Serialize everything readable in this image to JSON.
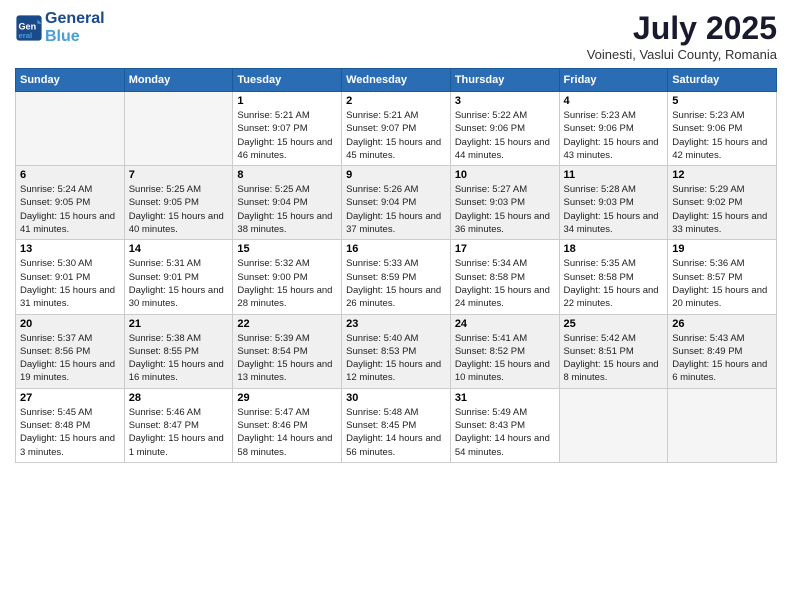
{
  "header": {
    "logo_line1": "General",
    "logo_line2": "Blue",
    "month_title": "July 2025",
    "location": "Voinesti, Vaslui County, Romania"
  },
  "days_of_week": [
    "Sunday",
    "Monday",
    "Tuesday",
    "Wednesday",
    "Thursday",
    "Friday",
    "Saturday"
  ],
  "weeks": [
    [
      {
        "day": "",
        "info": ""
      },
      {
        "day": "",
        "info": ""
      },
      {
        "day": "1",
        "info": "Sunrise: 5:21 AM\nSunset: 9:07 PM\nDaylight: 15 hours and 46 minutes."
      },
      {
        "day": "2",
        "info": "Sunrise: 5:21 AM\nSunset: 9:07 PM\nDaylight: 15 hours and 45 minutes."
      },
      {
        "day": "3",
        "info": "Sunrise: 5:22 AM\nSunset: 9:06 PM\nDaylight: 15 hours and 44 minutes."
      },
      {
        "day": "4",
        "info": "Sunrise: 5:23 AM\nSunset: 9:06 PM\nDaylight: 15 hours and 43 minutes."
      },
      {
        "day": "5",
        "info": "Sunrise: 5:23 AM\nSunset: 9:06 PM\nDaylight: 15 hours and 42 minutes."
      }
    ],
    [
      {
        "day": "6",
        "info": "Sunrise: 5:24 AM\nSunset: 9:05 PM\nDaylight: 15 hours and 41 minutes."
      },
      {
        "day": "7",
        "info": "Sunrise: 5:25 AM\nSunset: 9:05 PM\nDaylight: 15 hours and 40 minutes."
      },
      {
        "day": "8",
        "info": "Sunrise: 5:25 AM\nSunset: 9:04 PM\nDaylight: 15 hours and 38 minutes."
      },
      {
        "day": "9",
        "info": "Sunrise: 5:26 AM\nSunset: 9:04 PM\nDaylight: 15 hours and 37 minutes."
      },
      {
        "day": "10",
        "info": "Sunrise: 5:27 AM\nSunset: 9:03 PM\nDaylight: 15 hours and 36 minutes."
      },
      {
        "day": "11",
        "info": "Sunrise: 5:28 AM\nSunset: 9:03 PM\nDaylight: 15 hours and 34 minutes."
      },
      {
        "day": "12",
        "info": "Sunrise: 5:29 AM\nSunset: 9:02 PM\nDaylight: 15 hours and 33 minutes."
      }
    ],
    [
      {
        "day": "13",
        "info": "Sunrise: 5:30 AM\nSunset: 9:01 PM\nDaylight: 15 hours and 31 minutes."
      },
      {
        "day": "14",
        "info": "Sunrise: 5:31 AM\nSunset: 9:01 PM\nDaylight: 15 hours and 30 minutes."
      },
      {
        "day": "15",
        "info": "Sunrise: 5:32 AM\nSunset: 9:00 PM\nDaylight: 15 hours and 28 minutes."
      },
      {
        "day": "16",
        "info": "Sunrise: 5:33 AM\nSunset: 8:59 PM\nDaylight: 15 hours and 26 minutes."
      },
      {
        "day": "17",
        "info": "Sunrise: 5:34 AM\nSunset: 8:58 PM\nDaylight: 15 hours and 24 minutes."
      },
      {
        "day": "18",
        "info": "Sunrise: 5:35 AM\nSunset: 8:58 PM\nDaylight: 15 hours and 22 minutes."
      },
      {
        "day": "19",
        "info": "Sunrise: 5:36 AM\nSunset: 8:57 PM\nDaylight: 15 hours and 20 minutes."
      }
    ],
    [
      {
        "day": "20",
        "info": "Sunrise: 5:37 AM\nSunset: 8:56 PM\nDaylight: 15 hours and 19 minutes."
      },
      {
        "day": "21",
        "info": "Sunrise: 5:38 AM\nSunset: 8:55 PM\nDaylight: 15 hours and 16 minutes."
      },
      {
        "day": "22",
        "info": "Sunrise: 5:39 AM\nSunset: 8:54 PM\nDaylight: 15 hours and 13 minutes."
      },
      {
        "day": "23",
        "info": "Sunrise: 5:40 AM\nSunset: 8:53 PM\nDaylight: 15 hours and 12 minutes."
      },
      {
        "day": "24",
        "info": "Sunrise: 5:41 AM\nSunset: 8:52 PM\nDaylight: 15 hours and 10 minutes."
      },
      {
        "day": "25",
        "info": "Sunrise: 5:42 AM\nSunset: 8:51 PM\nDaylight: 15 hours and 8 minutes."
      },
      {
        "day": "26",
        "info": "Sunrise: 5:43 AM\nSunset: 8:49 PM\nDaylight: 15 hours and 6 minutes."
      }
    ],
    [
      {
        "day": "27",
        "info": "Sunrise: 5:45 AM\nSunset: 8:48 PM\nDaylight: 15 hours and 3 minutes."
      },
      {
        "day": "28",
        "info": "Sunrise: 5:46 AM\nSunset: 8:47 PM\nDaylight: 15 hours and 1 minute."
      },
      {
        "day": "29",
        "info": "Sunrise: 5:47 AM\nSunset: 8:46 PM\nDaylight: 14 hours and 58 minutes."
      },
      {
        "day": "30",
        "info": "Sunrise: 5:48 AM\nSunset: 8:45 PM\nDaylight: 14 hours and 56 minutes."
      },
      {
        "day": "31",
        "info": "Sunrise: 5:49 AM\nSunset: 8:43 PM\nDaylight: 14 hours and 54 minutes."
      },
      {
        "day": "",
        "info": ""
      },
      {
        "day": "",
        "info": ""
      }
    ]
  ]
}
